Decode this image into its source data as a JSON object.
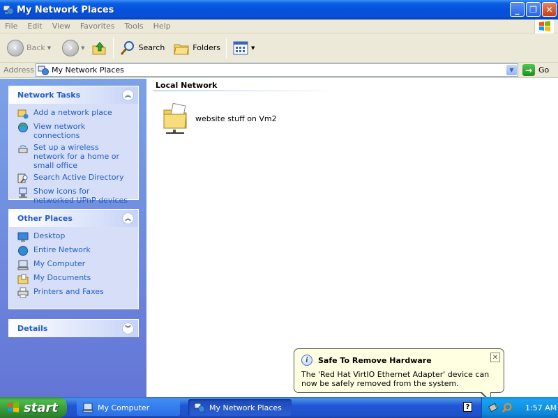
{
  "window": {
    "title": "My Network Places",
    "controls": [
      "_",
      "❐",
      "✕"
    ]
  },
  "menubar": {
    "items": [
      "File",
      "Edit",
      "View",
      "Favorites",
      "Tools",
      "Help"
    ]
  },
  "toolbar": {
    "back_label": "Back",
    "search_label": "Search",
    "folders_label": "Folders"
  },
  "addressbar": {
    "label": "Address",
    "value": "My Network Places",
    "go_label": "Go"
  },
  "network_tasks": {
    "title": "Network Tasks",
    "items": [
      {
        "label": "Add a network place",
        "icon": "add-network-place-icon"
      },
      {
        "label": "View network connections",
        "icon": "network-connections-icon"
      },
      {
        "label": "Set up a wireless network for a home or small office",
        "icon": "wireless-network-icon"
      },
      {
        "label": "Search Active Directory",
        "icon": "search-directory-icon"
      },
      {
        "label": "Show icons for networked UPnP devices",
        "icon": "upnp-devices-icon"
      }
    ]
  },
  "other_places": {
    "title": "Other Places",
    "items": [
      {
        "label": "Desktop",
        "icon": "desktop-icon"
      },
      {
        "label": "Entire Network",
        "icon": "entire-network-icon"
      },
      {
        "label": "My Computer",
        "icon": "my-computer-icon"
      },
      {
        "label": "My Documents",
        "icon": "my-documents-icon"
      },
      {
        "label": "Printers and Faxes",
        "icon": "printers-icon"
      }
    ]
  },
  "details": {
    "title": "Details"
  },
  "content": {
    "group_title": "Local Network",
    "items": [
      {
        "label": "website stuff on Vm2",
        "icon": "network-folder-icon"
      }
    ]
  },
  "balloon": {
    "title": "Safe To Remove Hardware",
    "text": "The 'Red Hat VirtIO Ethernet Adapter' device can now be safely removed from the system.",
    "close": "✕"
  },
  "taskbar": {
    "start_label": "start",
    "tasks": [
      {
        "label": "My Computer",
        "active": false
      },
      {
        "label": "My Network Places",
        "active": true
      }
    ],
    "clock": "1:57 AM"
  }
}
